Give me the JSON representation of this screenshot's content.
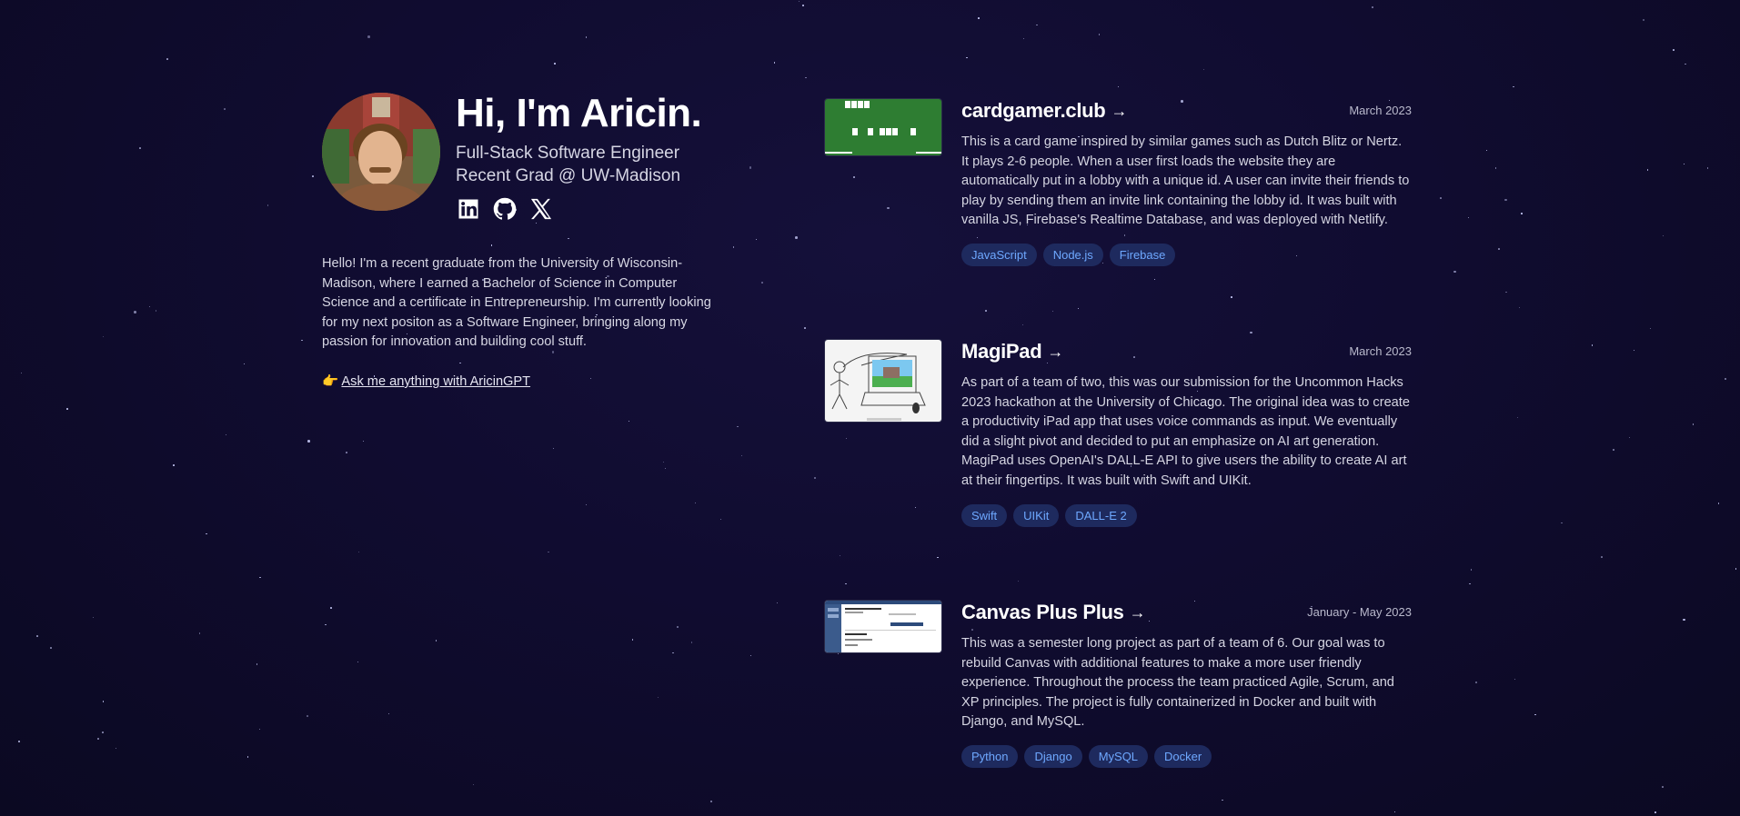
{
  "profile": {
    "name_heading": "Hi, I'm Aricin.",
    "role_line1": "Full-Stack Software Engineer",
    "role_line2": "Recent Grad @ UW-Madison",
    "socials": [
      {
        "label": "LinkedIn",
        "icon": "linkedin-icon"
      },
      {
        "label": "GitHub",
        "icon": "github-icon"
      },
      {
        "label": "X",
        "icon": "x-icon"
      }
    ],
    "bio": "Hello! I'm a recent graduate from the University of Wisconsin-Madison, where I earned a Bachelor of Science in Computer Science and a certificate in Entrepreneurship. I'm currently looking for my next positon as a Software Engineer, bringing along my passion for innovation and building cool stuff.",
    "ask_emoji": "👉",
    "ask_link": "Ask me anything with AricinGPT"
  },
  "projects": [
    {
      "title": "cardgamer.club",
      "arrow": "→",
      "date": "March 2023",
      "description": "This is a card game inspired by similar games such as Dutch Blitz or Nertz. It plays 2-6 people. When a user first loads the website they are automatically put in a lobby with a unique id. A user can invite their friends to play by sending them an invite link containing the lobby id. It was built with vanilla JS, Firebase's Realtime Database, and was deployed with Netlify.",
      "tags": [
        "JavaScript",
        "Node.js",
        "Firebase"
      ]
    },
    {
      "title": "MagiPad",
      "arrow": "→",
      "date": "March 2023",
      "description": "As part of a team of two, this was our submission for the Uncommon Hacks 2023 hackathon at the University of Chicago. The original idea was to create a productivity iPad app that uses voice commands as input. We eventually did a slight pivot and decided to put an emphasize on AI art generation. MagiPad uses OpenAI's DALL-E API to give users the ability to create AI art at their fingertips. It was built with Swift and UIKit.",
      "tags": [
        "Swift",
        "UIKit",
        "DALL-E 2"
      ]
    },
    {
      "title": "Canvas Plus Plus",
      "arrow": "→",
      "date": "January - May 2023",
      "description": "This was a semester long project as part of a team of 6. Our goal was to rebuild Canvas with additional features to make a more user friendly experience. Throughout the process the team practiced Agile, Scrum, and XP principles. The project is fully containerized in Docker and built with Django, and MySQL.",
      "tags": [
        "Python",
        "Django",
        "MySQL",
        "Docker"
      ]
    }
  ],
  "colors": {
    "background": "#100c30",
    "tag_background": "#1e2a5e",
    "tag_text": "#6ea8ff"
  }
}
